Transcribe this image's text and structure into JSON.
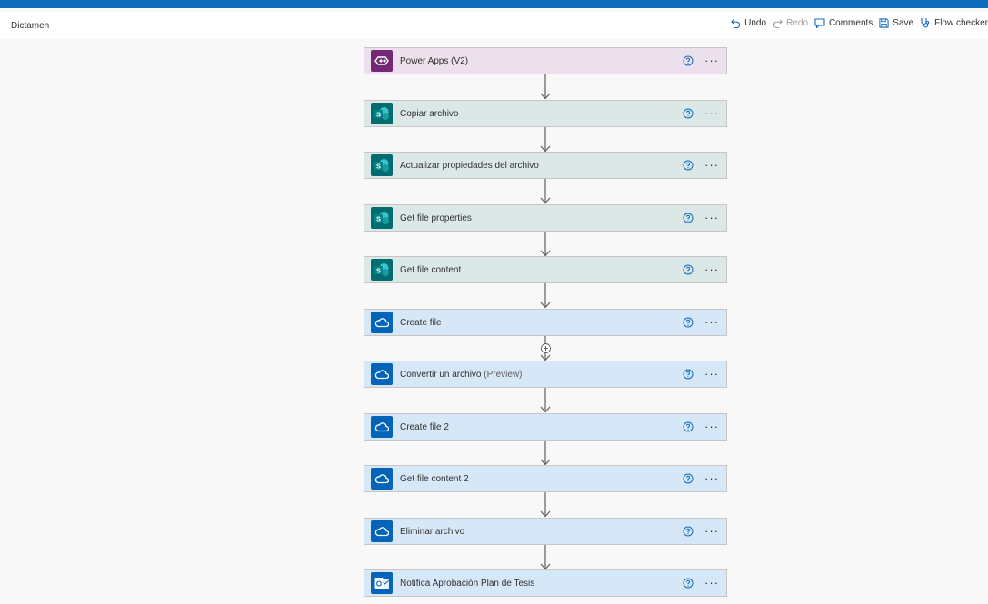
{
  "flow": {
    "name": "Dictamen"
  },
  "toolbar": {
    "undo": "Undo",
    "redo": "Redo",
    "comments": "Comments",
    "save": "Save",
    "flow_checker": "Flow checker"
  },
  "steps": [
    {
      "title": "Power Apps (V2)",
      "tag": "",
      "connector": "power-apps",
      "icon": "power-apps-icon"
    },
    {
      "title": "Copiar archivo",
      "tag": "",
      "connector": "sharepoint",
      "icon": "sharepoint-icon"
    },
    {
      "title": "Actualizar propiedades del archivo",
      "tag": "",
      "connector": "sharepoint",
      "icon": "sharepoint-icon"
    },
    {
      "title": "Get file properties",
      "tag": "",
      "connector": "sharepoint",
      "icon": "sharepoint-icon"
    },
    {
      "title": "Get file content",
      "tag": "",
      "connector": "sharepoint",
      "icon": "sharepoint-icon"
    },
    {
      "title": "Create file",
      "tag": "",
      "connector": "onedrive",
      "icon": "onedrive-icon"
    },
    {
      "title": "Convertir un archivo",
      "tag": "(Preview)",
      "connector": "onedrive",
      "icon": "onedrive-icon"
    },
    {
      "title": "Create file 2",
      "tag": "",
      "connector": "onedrive",
      "icon": "onedrive-icon"
    },
    {
      "title": "Get file content 2",
      "tag": "",
      "connector": "onedrive",
      "icon": "onedrive-icon"
    },
    {
      "title": "Eliminar archivo",
      "tag": "",
      "connector": "onedrive",
      "icon": "onedrive-icon"
    },
    {
      "title": "Notifica Aprobación Plan de Tesis",
      "tag": "",
      "connector": "outlook",
      "icon": "outlook-icon"
    }
  ],
  "more_label": "···",
  "colors": {
    "accent": "#0f6cbd",
    "power_apps": "#742774",
    "sharepoint": "#036c70",
    "onedrive": "#0364b8"
  }
}
